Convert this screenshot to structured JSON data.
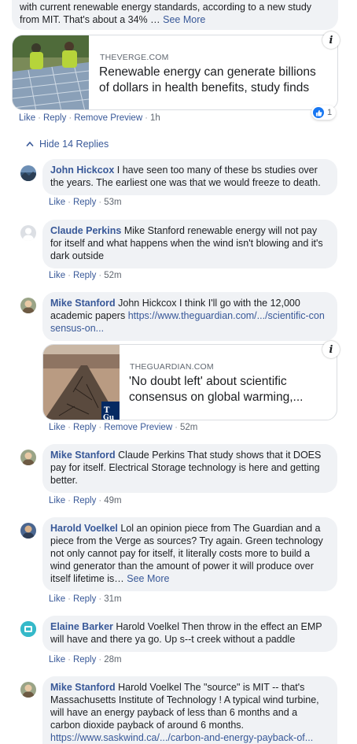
{
  "top_post": {
    "text_line1": "with current renewable energy standards, according to a new study",
    "text_line2": "from MIT. That's about a 34%",
    "ellipsis": "…",
    "see_more": "See More",
    "card": {
      "domain": "THEVERGE.COM",
      "title": "Renewable energy can generate billions of dollars in health benefits, study finds"
    },
    "actions": {
      "like": "Like",
      "reply": "Reply",
      "remove_preview": "Remove Preview",
      "time": "1h"
    },
    "reaction_count": "1"
  },
  "hide_replies": "Hide 14 Replies",
  "replies": [
    {
      "author": "John Hickcox",
      "text": "I have seen too many of these bs studies over the years. The earliest one was that we would freeze to death.",
      "like": "Like",
      "reply": "Reply",
      "time": "53m"
    },
    {
      "author": "Claude Perkins",
      "text": "Mike Stanford renewable energy will not pay for itself and what happens when the wind isn't blowing and it's dark outside",
      "like": "Like",
      "reply": "Reply",
      "time": "52m"
    },
    {
      "author": "Mike Stanford",
      "text": "John Hickcox I think I'll go with the 12,000 academic papers",
      "link": "https://www.theguardian.com/.../scientific-consensus-on...",
      "card": {
        "domain": "THEGUARDIAN.COM",
        "title": "'No doubt left' about scientific consensus on global warming,...",
        "logo_text": "The Guardian"
      },
      "like": "Like",
      "reply": "Reply",
      "remove_preview": "Remove Preview",
      "time": "52m"
    },
    {
      "author": "Mike Stanford",
      "text": "Claude Perkins That study shows that it DOES pay for itself. Electrical Storage technology is here and getting better.",
      "like": "Like",
      "reply": "Reply",
      "time": "49m"
    },
    {
      "author": "Harold Voelkel",
      "text": "Lol an opinion piece from The Guardian and a piece from the Verge as sources? Try again. Green technology not only cannot pay for itself, it literally costs more to build a wind generator than the amount of power it will produce over itself lifetime is…",
      "see_more": "See More",
      "like": "Like",
      "reply": "Reply",
      "time": "31m"
    },
    {
      "author": "Elaine Barker",
      "text": "Harold Voelkel Then throw in the effect an EMP will have and there ya go. Up s--t creek without a paddle",
      "like": "Like",
      "reply": "Reply",
      "time": "28m"
    },
    {
      "author": "Mike Stanford",
      "text": "Harold Voelkel The \"source\" is MIT -- that's Massachusetts Institute of Technology ! A typical wind turbine, will have an energy payback of less than 6 months and a carbon dioxide payback of around 6 months.",
      "link": "https://www.saskwind.ca/.../carbon-and-energy-payback-of..."
    }
  ],
  "colors": {
    "link": "#385898",
    "bubble": "#f0f2f5",
    "text": "#1c1e21",
    "meta": "#606770",
    "like_blue": "#1877f2"
  },
  "icons": [
    "info-icon",
    "thumbs-up-icon",
    "chevron-up-icon",
    "avatar-placeholder-icon"
  ]
}
